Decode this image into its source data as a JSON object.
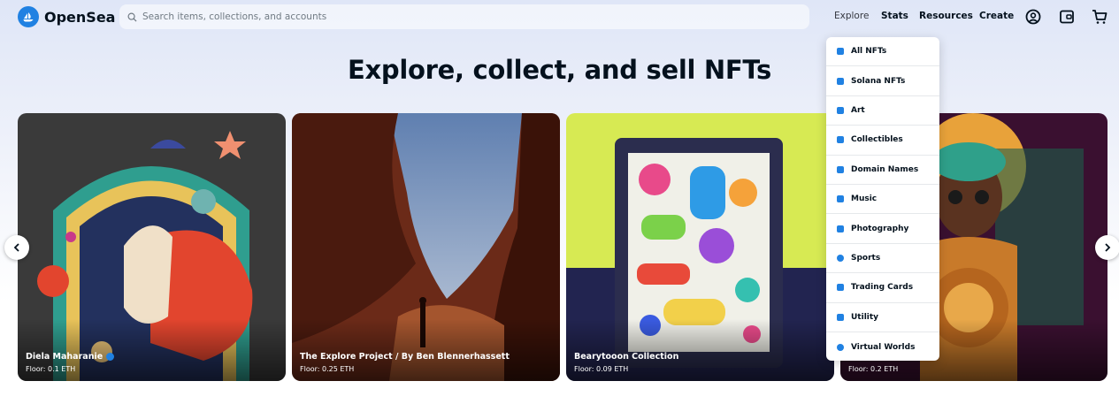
{
  "header": {
    "logo_text": "OpenSea",
    "search_placeholder": "Search items, collections, and accounts",
    "nav": [
      "Explore",
      "Stats",
      "Resources",
      "Create"
    ]
  },
  "hero": {
    "title": "Explore, collect, and sell NFTs"
  },
  "cards": [
    {
      "name": "Diela Maharanie",
      "floor": "Floor: 0.1 ETH",
      "verified": true
    },
    {
      "name": "The Explore Project / By Ben Blennerhassett",
      "floor": "Floor: 0.25 ETH",
      "verified": false
    },
    {
      "name": "Bearytooon Collection",
      "floor": "Floor: 0.09 ETH",
      "verified": false
    },
    {
      "name": "",
      "floor": "Floor: 0.2 ETH",
      "verified": false
    }
  ],
  "explore_menu": {
    "items": [
      {
        "label": "All NFTs",
        "icon": "grid-icon",
        "color": "#2081e2"
      },
      {
        "label": "Solana NFTs",
        "icon": "solana-icon",
        "color": "#2081e2"
      },
      {
        "label": "Art",
        "icon": "palette-icon",
        "color": "#2081e2"
      },
      {
        "label": "Collectibles",
        "icon": "collectibles-icon",
        "color": "#2081e2"
      },
      {
        "label": "Domain Names",
        "icon": "domain-icon",
        "color": "#2081e2"
      },
      {
        "label": "Music",
        "icon": "music-icon",
        "color": "#2081e2"
      },
      {
        "label": "Photography",
        "icon": "camera-icon",
        "color": "#2081e2"
      },
      {
        "label": "Sports",
        "icon": "ball-icon",
        "color": "#2081e2"
      },
      {
        "label": "Trading Cards",
        "icon": "card-icon",
        "color": "#2081e2"
      },
      {
        "label": "Utility",
        "icon": "utility-icon",
        "color": "#2081e2"
      },
      {
        "label": "Virtual Worlds",
        "icon": "globe-icon",
        "color": "#2081e2"
      }
    ]
  },
  "colors": {
    "brand": "#2081e2",
    "text": "#04111d"
  }
}
